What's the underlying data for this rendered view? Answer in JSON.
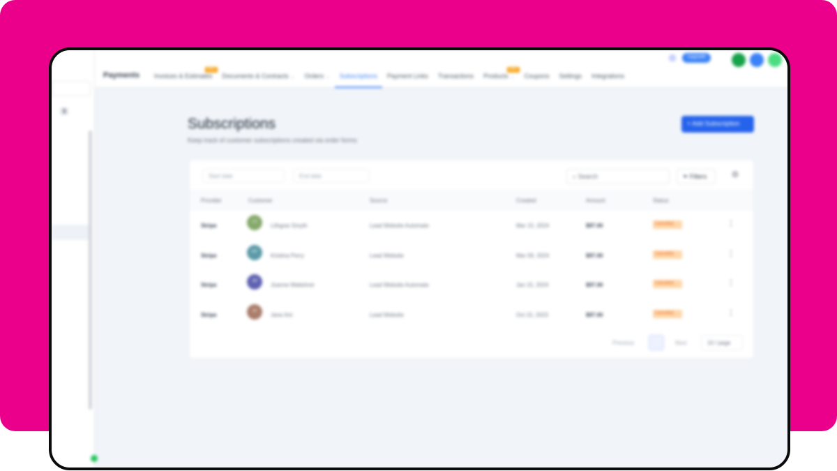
{
  "colors": {
    "backdrop": "#ea008b",
    "accent": "#2563eb",
    "status_badge": "#fed7aa",
    "status_text": "#ea580c"
  },
  "sidebar": {
    "select_label": "",
    "pill_label": "",
    "pill_tag": "$",
    "rows": [
      "",
      "",
      "",
      "",
      "",
      "",
      "",
      ""
    ]
  },
  "header": {
    "brand": "Payments",
    "upgrade_label": "Upgrade",
    "tabs": [
      {
        "label": "Invoices & Estimates",
        "new": true,
        "caret": false
      },
      {
        "label": "Documents & Contracts",
        "new": false,
        "caret": true
      },
      {
        "label": "Orders",
        "new": false,
        "caret": true
      },
      {
        "label": "Subscriptions",
        "new": false,
        "caret": false,
        "active": true
      },
      {
        "label": "Payment Links",
        "new": false,
        "caret": false
      },
      {
        "label": "Transactions",
        "new": false,
        "caret": false
      },
      {
        "label": "Products",
        "new": true,
        "caret": true
      },
      {
        "label": "Coupons",
        "new": false,
        "caret": false
      },
      {
        "label": "Settings",
        "new": false,
        "caret": false
      },
      {
        "label": "Integrations",
        "new": false,
        "caret": false
      }
    ],
    "new_badge": "NEW"
  },
  "main": {
    "title": "Subscriptions",
    "subtitle": "Keep track of customer subscriptions created via order forms",
    "add_button": "+ Add Subscription",
    "toolbar": {
      "date_placeholder": "Start date",
      "end_placeholder": "End date",
      "search_placeholder": "Search",
      "filters_label": "Filters"
    },
    "columns": [
      "Provider",
      "Customer",
      "Source",
      "Created",
      "Amount",
      "Status"
    ],
    "rows": [
      {
        "provider": "Stripe",
        "initials": "LS",
        "customer": "Lithgow Smyth",
        "source": "Lead Website Automate",
        "created": "Mar 15, 2024",
        "amount": "$97.00",
        "status": "Cancelled",
        "color": "#84a96a"
      },
      {
        "provider": "Stripe",
        "initials": "KP",
        "customer": "Kristina Perry",
        "source": "Lead Website",
        "created": "Mar 09, 2024",
        "amount": "$97.00",
        "status": "Cancelled",
        "color": "#5b9aa8"
      },
      {
        "provider": "Stripe",
        "initials": "JM",
        "customer": "Joanne Mattehret",
        "source": "Lead Website Automate",
        "created": "Jan 15, 2024",
        "amount": "$97.00",
        "status": "Cancelled",
        "color": "#5e62b0"
      },
      {
        "provider": "Stripe",
        "initials": "JA",
        "customer": "Jane Ant",
        "source": "Lead Website",
        "created": "Oct 15, 2023",
        "amount": "$97.00",
        "status": "Cancelled",
        "color": "#a97d6a"
      }
    ],
    "pagination": {
      "prev": "Previous",
      "page": "1",
      "next": "Next",
      "page_size": "10 / page"
    }
  }
}
